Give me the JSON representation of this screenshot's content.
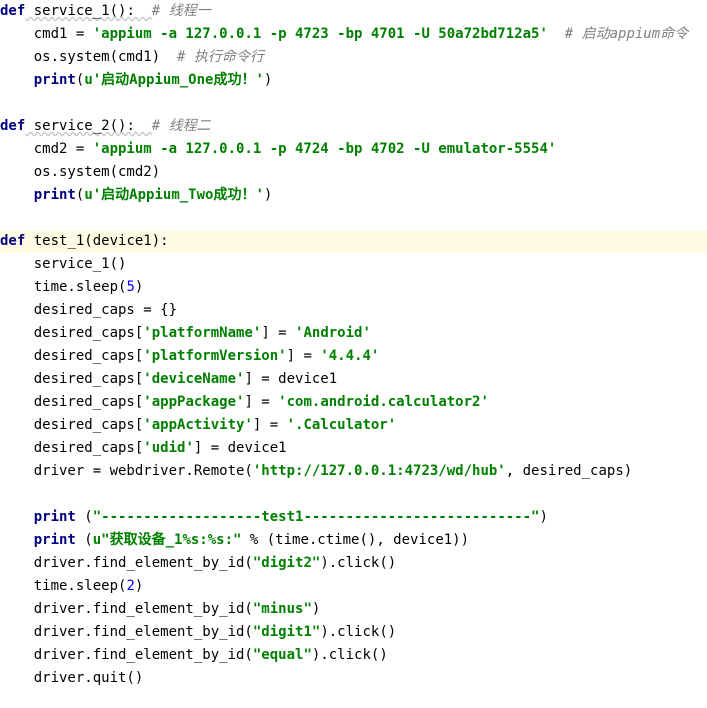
{
  "code": {
    "lines": [
      [
        {
          "t": "def",
          "c": "kw"
        },
        {
          "t": " service_1():  ",
          "c": "nm"
        },
        {
          "t": "# 线程一",
          "c": "cm"
        }
      ],
      [
        {
          "t": "    cmd1 = ",
          "c": "nm"
        },
        {
          "t": "'appium -a 127.0.0.1 -p 4723 -bp 4701 -U 50a72bd712a5'",
          "c": "str"
        },
        {
          "t": "  ",
          "c": "nm"
        },
        {
          "t": "# 启动appium命令",
          "c": "cm"
        }
      ],
      [
        {
          "t": "    os.system(cmd1)  ",
          "c": "nm"
        },
        {
          "t": "# 执行命令行",
          "c": "cm"
        }
      ],
      [
        {
          "t": "    ",
          "c": "nm"
        },
        {
          "t": "print",
          "c": "kw"
        },
        {
          "t": "(",
          "c": "nm"
        },
        {
          "t": "u'启动Appium_One成功！'",
          "c": "str"
        },
        {
          "t": ")",
          "c": "nm"
        }
      ],
      [],
      [
        {
          "t": "def",
          "c": "kw"
        },
        {
          "t": " service_2():  ",
          "c": "nm"
        },
        {
          "t": "# 线程二",
          "c": "cm"
        }
      ],
      [
        {
          "t": "    cmd2 = ",
          "c": "nm"
        },
        {
          "t": "'appium -a 127.0.0.1 -p 4724 -bp 4702 -U emulator-5554'",
          "c": "str"
        }
      ],
      [
        {
          "t": "    os.system(cmd2)",
          "c": "nm"
        }
      ],
      [
        {
          "t": "    ",
          "c": "nm"
        },
        {
          "t": "print",
          "c": "kw"
        },
        {
          "t": "(",
          "c": "nm"
        },
        {
          "t": "u'启动Appium_Two成功！'",
          "c": "str"
        },
        {
          "t": ")",
          "c": "nm"
        }
      ],
      [],
      [
        {
          "t": "def",
          "c": "kw"
        },
        {
          "t": " test_1(device1):",
          "c": "nm"
        }
      ],
      [
        {
          "t": "    service_1()",
          "c": "nm"
        }
      ],
      [
        {
          "t": "    time.sleep(",
          "c": "nm"
        },
        {
          "t": "5",
          "c": "num"
        },
        {
          "t": ")",
          "c": "nm"
        }
      ],
      [
        {
          "t": "    desired_caps = {}",
          "c": "nm"
        }
      ],
      [
        {
          "t": "    desired_caps[",
          "c": "nm"
        },
        {
          "t": "'platformName'",
          "c": "str"
        },
        {
          "t": "] = ",
          "c": "nm"
        },
        {
          "t": "'Android'",
          "c": "str"
        }
      ],
      [
        {
          "t": "    desired_caps[",
          "c": "nm"
        },
        {
          "t": "'platformVersion'",
          "c": "str"
        },
        {
          "t": "] = ",
          "c": "nm"
        },
        {
          "t": "'4.4.4'",
          "c": "str"
        }
      ],
      [
        {
          "t": "    desired_caps[",
          "c": "nm"
        },
        {
          "t": "'deviceName'",
          "c": "str"
        },
        {
          "t": "] = device1",
          "c": "nm"
        }
      ],
      [
        {
          "t": "    desired_caps[",
          "c": "nm"
        },
        {
          "t": "'appPackage'",
          "c": "str"
        },
        {
          "t": "] = ",
          "c": "nm"
        },
        {
          "t": "'com.android.calculator2'",
          "c": "str"
        }
      ],
      [
        {
          "t": "    desired_caps[",
          "c": "nm"
        },
        {
          "t": "'appActivity'",
          "c": "str"
        },
        {
          "t": "] = ",
          "c": "nm"
        },
        {
          "t": "'.Calculator'",
          "c": "str"
        }
      ],
      [
        {
          "t": "    desired_caps[",
          "c": "nm"
        },
        {
          "t": "'udid'",
          "c": "str"
        },
        {
          "t": "] = device1",
          "c": "nm"
        }
      ],
      [
        {
          "t": "    driver = webdriver.Remote(",
          "c": "nm"
        },
        {
          "t": "'http://127.0.0.1:4723/wd/hub'",
          "c": "str"
        },
        {
          "t": ", desired_caps)",
          "c": "nm"
        }
      ],
      [],
      [
        {
          "t": "    ",
          "c": "nm"
        },
        {
          "t": "print",
          "c": "kw"
        },
        {
          "t": " (",
          "c": "nm"
        },
        {
          "t": "\"-------------------test1---------------------------\"",
          "c": "str"
        },
        {
          "t": ")",
          "c": "nm"
        }
      ],
      [
        {
          "t": "    ",
          "c": "nm"
        },
        {
          "t": "print",
          "c": "kw"
        },
        {
          "t": " (",
          "c": "nm"
        },
        {
          "t": "u\"获取设备_1%s:%s:\"",
          "c": "str"
        },
        {
          "t": " % (time.ctime(), device1))",
          "c": "nm"
        }
      ],
      [
        {
          "t": "    driver.find_element_by_id(",
          "c": "nm"
        },
        {
          "t": "\"digit2\"",
          "c": "str"
        },
        {
          "t": ").click()",
          "c": "nm"
        }
      ],
      [
        {
          "t": "    time.sleep(",
          "c": "nm"
        },
        {
          "t": "2",
          "c": "num"
        },
        {
          "t": ")",
          "c": "nm"
        }
      ],
      [
        {
          "t": "    driver.find_element_by_id(",
          "c": "nm"
        },
        {
          "t": "\"minus\"",
          "c": "str"
        },
        {
          "t": ")",
          "c": "nm"
        }
      ],
      [
        {
          "t": "    driver.find_element_by_id(",
          "c": "nm"
        },
        {
          "t": "\"digit1\"",
          "c": "str"
        },
        {
          "t": ").click()",
          "c": "nm"
        }
      ],
      [
        {
          "t": "    driver.find_element_by_id(",
          "c": "nm"
        },
        {
          "t": "\"equal\"",
          "c": "str"
        },
        {
          "t": ").click()",
          "c": "nm"
        }
      ],
      [
        {
          "t": "    driver.quit()",
          "c": "nm"
        }
      ]
    ]
  }
}
